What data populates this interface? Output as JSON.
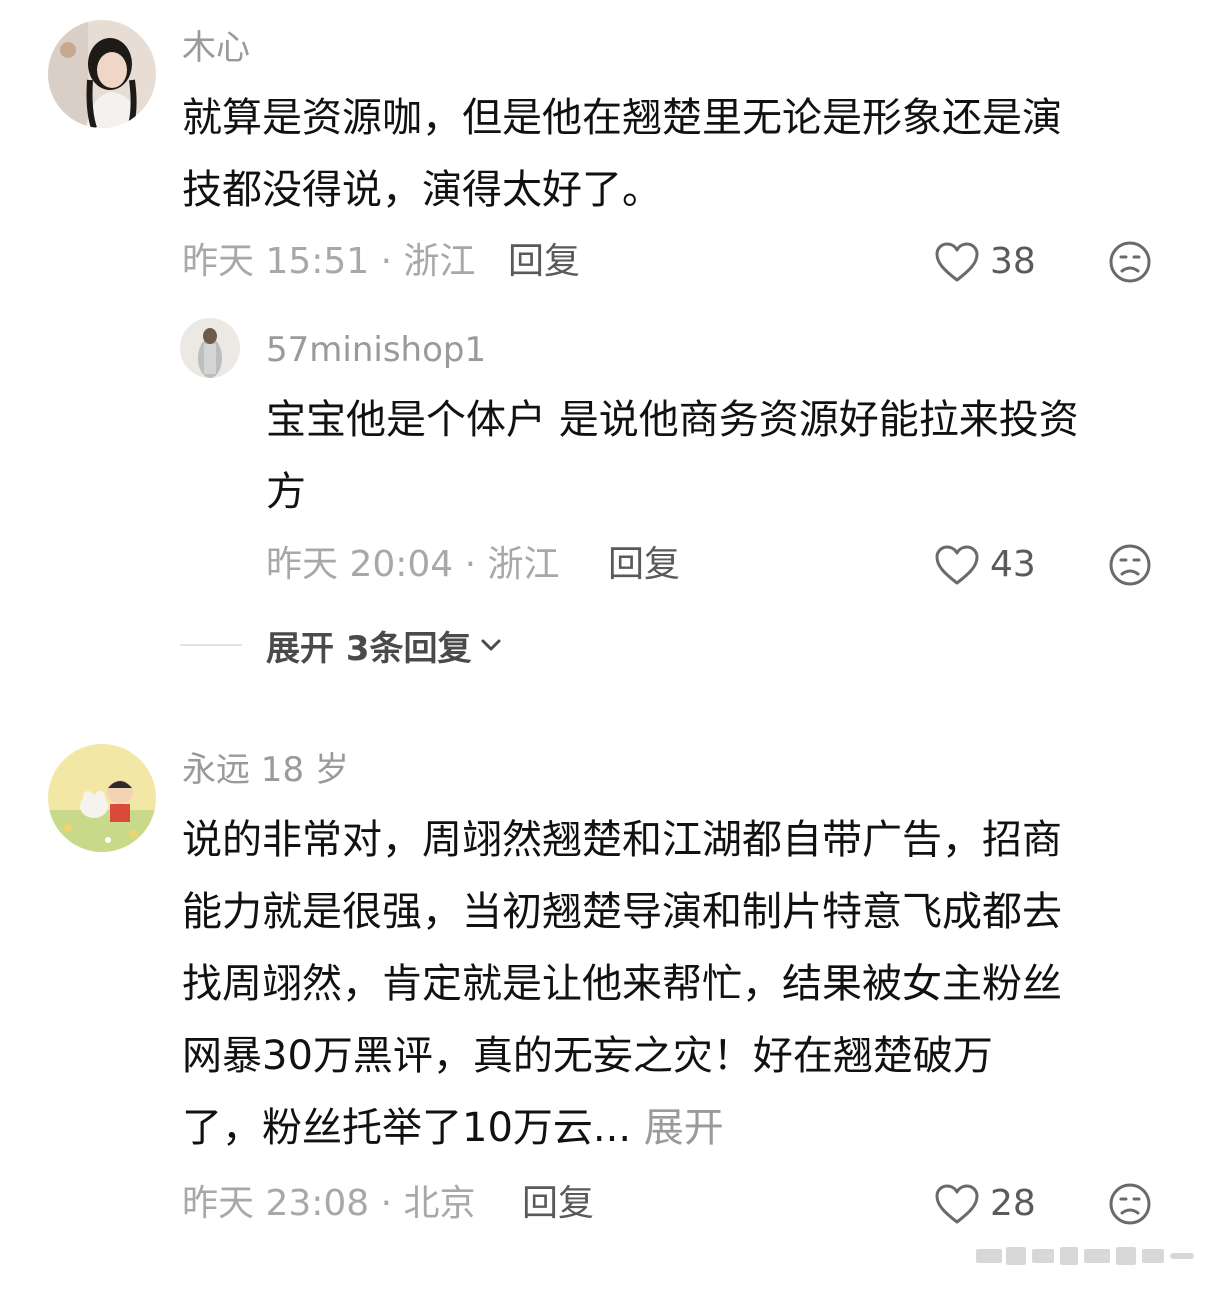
{
  "comments": [
    {
      "username": "木心",
      "text_lines": [
        "就算是资源咖，但是他在翘楚里无论是形象还是演",
        "技都没得说，演得太好了。"
      ],
      "meta": "昨天 15:51 · 浙江",
      "reply_label": "回复",
      "likes": "38",
      "icons": {
        "like": "heart-outline-icon",
        "dislike": "sad-face-icon"
      },
      "replies": [
        {
          "username": "57minishop1",
          "text_lines": [
            "宝宝他是个体户 是说他商务资源好能拉来投资",
            "方"
          ],
          "meta": "昨天 20:04 · 浙江",
          "reply_label": "回复",
          "likes": "43"
        }
      ],
      "expand_replies_label": "展开 3条回复"
    },
    {
      "username": "永远 18 岁",
      "text_lines": [
        "说的非常对，周翊然翘楚和江湖都自带广告，招商",
        "能力就是很强，当初翘楚导演和制片特意飞成都去",
        "找周翊然，肯定就是让他来帮忙，结果被女主粉丝",
        "网暴30万黑评，真的无妄之灾！好在翘楚破万",
        "了，粉丝托举了10万云..."
      ],
      "expand_text_label": "展开",
      "meta": "昨天 23:08 · 北京",
      "reply_label": "回复",
      "likes": "28"
    }
  ],
  "colors": {
    "text": "#111111",
    "muted": "#a8a8a8",
    "username": "#9a9a9a",
    "action": "#5a5a5a"
  }
}
